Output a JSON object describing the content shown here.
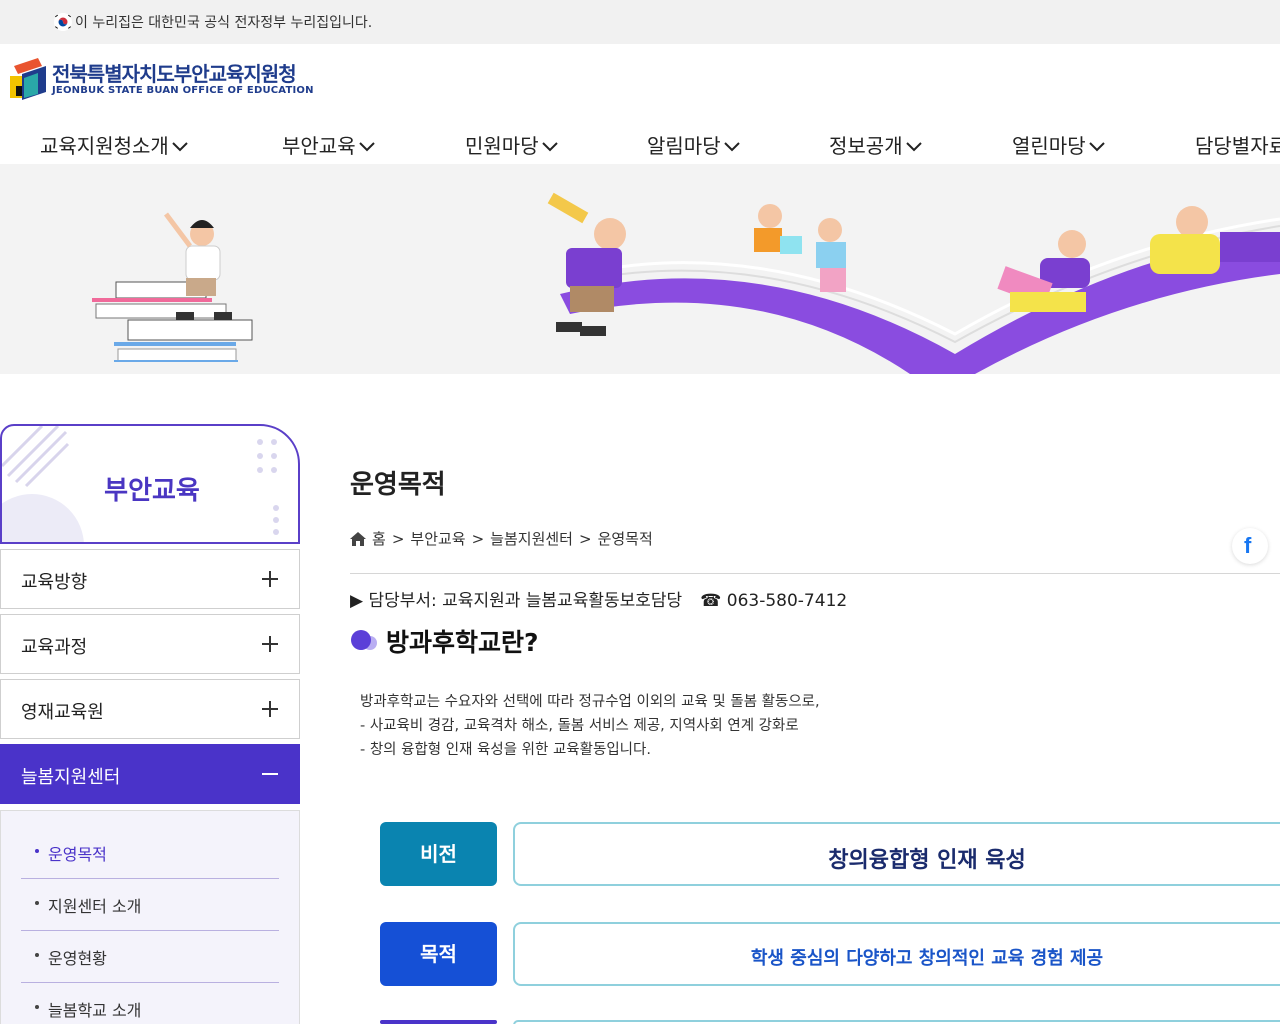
{
  "gov_banner": {
    "text": "이 누리집은 대한민국 공식 전자정부 누리집입니다."
  },
  "logo": {
    "name_kr": "전북특별자치도부안교육지원청",
    "name_en": "JEONBUK STATE BUAN OFFICE OF EDUCATION"
  },
  "gnb": [
    {
      "label": "교육지원청소개"
    },
    {
      "label": "부안교육"
    },
    {
      "label": "민원마당"
    },
    {
      "label": "알림마당"
    },
    {
      "label": "정보공개"
    },
    {
      "label": "열린마당"
    },
    {
      "label": "담당별자료"
    }
  ],
  "sidebar": {
    "title": "부안교육",
    "items": [
      {
        "label": "교육방향"
      },
      {
        "label": "교육과정"
      },
      {
        "label": "영재교육원"
      },
      {
        "label": "늘봄지원센터"
      }
    ],
    "sub_items": [
      {
        "label": "운영목적"
      },
      {
        "label": "지원센터 소개"
      },
      {
        "label": "운영현황"
      },
      {
        "label": "늘봄학교 소개"
      }
    ]
  },
  "content": {
    "page_title": "운영목적",
    "breadcrumb": [
      "홈",
      "부안교육",
      "늘봄지원센터",
      "운영목적"
    ],
    "breadcrumb_sep": ">",
    "dept_text": "▶ 담당부서: 교육지원과 늘봄교육활동보호담당",
    "phone": "☎ 063-580-7412",
    "section_title": "방과후학교란?",
    "description": [
      "방과후학교는 수요자와 선택에 따라 정규수업 이외의 교육 및 돌봄 활동으로,",
      "- 사교육비 경감, 교육격차 해소, 돌봄 서비스 제공, 지역사회 연계 강화로",
      "- 창의 융합형 인재 육성을 위한 교육활동입니다."
    ],
    "rows": [
      {
        "label": "비전",
        "text": "창의융합형 인재 육성",
        "label_color": "#0a84b0",
        "text_color": "#1a2b6d"
      },
      {
        "label": "목적",
        "text": "학생 중심의 다양하고 창의적인 교육 경험 제공",
        "label_color": "#1550d6",
        "text_color": "#1a55c8"
      }
    ]
  },
  "share": {
    "facebook": "f"
  },
  "colors": {
    "primary": "#4a33c9",
    "brand": "#1f3c8c"
  }
}
